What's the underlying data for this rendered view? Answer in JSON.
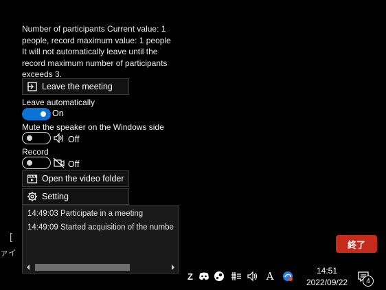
{
  "description": "Number of participants Current value: 1 people, record maximum value: 1 people It will not automatically leave until the record maximum number of participants exceeds 3.",
  "buttons": {
    "leave": "Leave the meeting",
    "video_folder": "Open the video folder",
    "setting": "Setting"
  },
  "auto_leave": {
    "label": "Leave automatically",
    "state": "On"
  },
  "mute_speaker": {
    "label": "Mute the speaker on the Windows side",
    "state": "Off"
  },
  "record": {
    "label": "Record",
    "state": "Off"
  },
  "log": [
    "14:49:03 Participate in a meeting",
    "14:49:09 Started acquisition of the numbe"
  ],
  "left_edge_fragment": {
    "bracket": "[",
    "text": "ァイ"
  },
  "end_button": "終了",
  "taskbar": {
    "time": "14:51",
    "date": "2022/09/22",
    "notification_count": "4",
    "ime_label": "A",
    "partial_glyph": "Z"
  },
  "colors": {
    "accent": "#0a74d6",
    "end_button": "#c42b1c"
  }
}
